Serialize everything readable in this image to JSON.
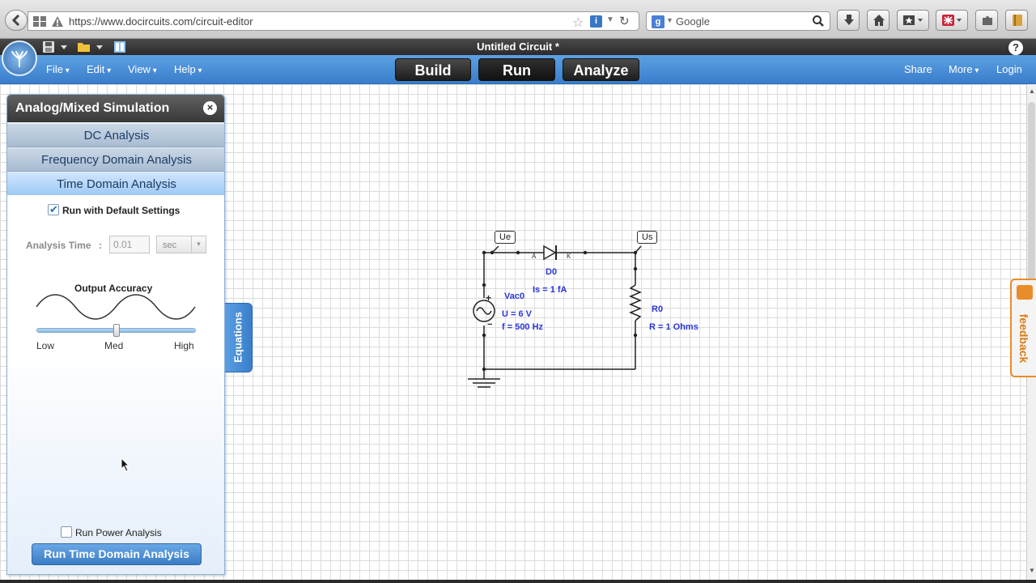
{
  "browser": {
    "url": "https://www.docircuits.com/circuit-editor",
    "search_placeholder": "Google"
  },
  "app": {
    "title": "Untitled Circuit *",
    "menu": [
      "File",
      "Edit",
      "View",
      "Help"
    ],
    "modes": [
      "Build",
      "Run",
      "Analyze"
    ],
    "active_mode": "Run",
    "right_links": [
      "Share",
      "More",
      "Login"
    ],
    "help": "?"
  },
  "panel": {
    "title": "Analog/Mixed Simulation",
    "close": "×",
    "sections": [
      "DC Analysis",
      "Frequency Domain Analysis",
      "Time Domain Analysis"
    ],
    "active_section": "Time Domain Analysis",
    "default_settings_label": "Run with Default Settings",
    "default_settings_checked": true,
    "analysis_time_label": "Analysis Time",
    "analysis_time_sep": ":",
    "analysis_time_value": "0.01",
    "analysis_time_unit": "sec",
    "accuracy_label": "Output Accuracy",
    "accuracy_ticks": [
      "Low",
      "Med",
      "High"
    ],
    "accuracy_level": 0.5,
    "power_analysis_label": "Run Power Analysis",
    "power_analysis_checked": false,
    "run_button": "Run Time Domain Analysis"
  },
  "side_tabs": {
    "equations": "Equations",
    "feedback": "feedback"
  },
  "circuit": {
    "probes": [
      "Ue",
      "Us"
    ],
    "diode": {
      "name": "D0",
      "param": "Is = 1 fA",
      "anode": "A",
      "cathode": "K"
    },
    "source": {
      "name": "Vac0",
      "voltage": "U = 6 V",
      "frequency": "f = 500 Hz",
      "plus": "+",
      "minus": "−"
    },
    "resistor": {
      "name": "R0",
      "param": "R = 1 Ohms"
    }
  },
  "colors": {
    "accent_blue": "#3a7ecb",
    "label_blue": "#2a36d8",
    "feedback_orange": "#e98d2b"
  }
}
